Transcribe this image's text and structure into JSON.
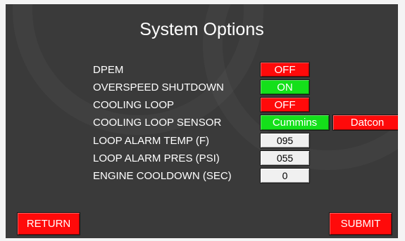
{
  "title": "System Options",
  "rows": [
    {
      "label": "DPEM",
      "value": "OFF",
      "state_color": "#ff0a0a"
    },
    {
      "label": "OVERSPEED SHUTDOWN",
      "value": "ON",
      "state_color": "#14e01a"
    },
    {
      "label": "COOLING LOOP",
      "value": "OFF",
      "state_color": "#ff0a0a"
    },
    {
      "label": "COOLING LOOP SENSOR",
      "options": [
        "Cummins",
        "Datcon"
      ],
      "selected": "Cummins"
    },
    {
      "label": "LOOP ALARM TEMP (F)",
      "value": "095"
    },
    {
      "label": "LOOP ALARM PRES (PSI)",
      "value": "055"
    },
    {
      "label": "ENGINE COOLDOWN (SEC)",
      "value": "0"
    }
  ],
  "buttons": {
    "return_label": "RETURN",
    "submit_label": "SUBMIT"
  },
  "colors": {
    "background": "#3a3a3a",
    "on": "#14e01a",
    "off": "#ff0a0a",
    "field": "#f0f0f0"
  }
}
